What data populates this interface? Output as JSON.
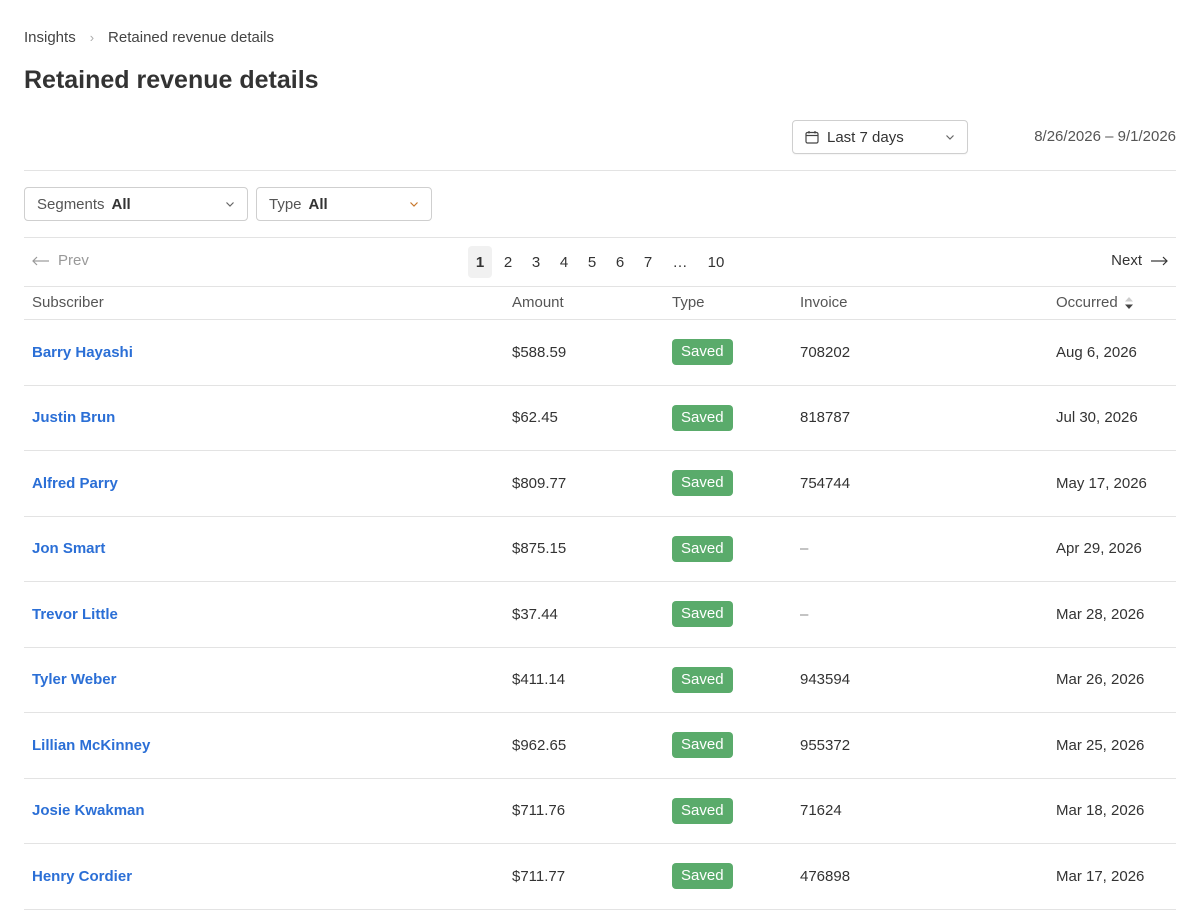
{
  "breadcrumb": {
    "parent": "Insights",
    "separator": "›",
    "current": "Retained revenue details"
  },
  "page_title": "Retained revenue details",
  "date_filter": {
    "value": "Last 7 days",
    "range": "8/26/2026 – 9/1/2026"
  },
  "filters": {
    "segments": {
      "label": "Segments",
      "value": "All"
    },
    "type": {
      "label": "Type",
      "value": "All"
    }
  },
  "pagination": {
    "prev_label": "Prev",
    "next_label": "Next",
    "pages": [
      "1",
      "2",
      "3",
      "4",
      "5",
      "6",
      "7"
    ],
    "ellipsis": "…",
    "last": "10",
    "current": "1"
  },
  "table": {
    "columns": {
      "subscriber": "Subscriber",
      "amount": "Amount",
      "type": "Type",
      "invoice": "Invoice",
      "occurred": "Occurred"
    },
    "rows": [
      {
        "subscriber": "Barry Hayashi",
        "amount": "$588.59",
        "type": "Saved",
        "invoice": "708202",
        "occurred": "Aug 6, 2026"
      },
      {
        "subscriber": "Justin Brun",
        "amount": "$62.45",
        "type": "Saved",
        "invoice": "818787",
        "occurred": "Jul 30, 2026"
      },
      {
        "subscriber": "Alfred Parry",
        "amount": "$809.77",
        "type": "Saved",
        "invoice": "754744",
        "occurred": "May 17, 2026"
      },
      {
        "subscriber": "Jon Smart",
        "amount": "$875.15",
        "type": "Saved",
        "invoice": "–",
        "occurred": "Apr 29, 2026"
      },
      {
        "subscriber": "Trevor Little",
        "amount": "$37.44",
        "type": "Saved",
        "invoice": "–",
        "occurred": "Mar 28, 2026"
      },
      {
        "subscriber": "Tyler Weber",
        "amount": "$411.14",
        "type": "Saved",
        "invoice": "943594",
        "occurred": "Mar 26, 2026"
      },
      {
        "subscriber": "Lillian McKinney",
        "amount": "$962.65",
        "type": "Saved",
        "invoice": "955372",
        "occurred": "Mar 25, 2026"
      },
      {
        "subscriber": "Josie Kwakman",
        "amount": "$711.76",
        "type": "Saved",
        "invoice": "71624",
        "occurred": "Mar 18, 2026"
      },
      {
        "subscriber": "Henry Cordier",
        "amount": "$711.77",
        "type": "Saved",
        "invoice": "476898",
        "occurred": "Mar 17, 2026"
      }
    ]
  },
  "colors": {
    "link": "#2b6fd6",
    "badge": "#5aab6b",
    "border": "#e3e3e3"
  },
  "icons": {
    "date": "calendar-icon",
    "dropdown": "chevron-down-icon",
    "prev": "arrow-left-icon",
    "next": "arrow-right-icon",
    "sort": "sort-icon"
  }
}
